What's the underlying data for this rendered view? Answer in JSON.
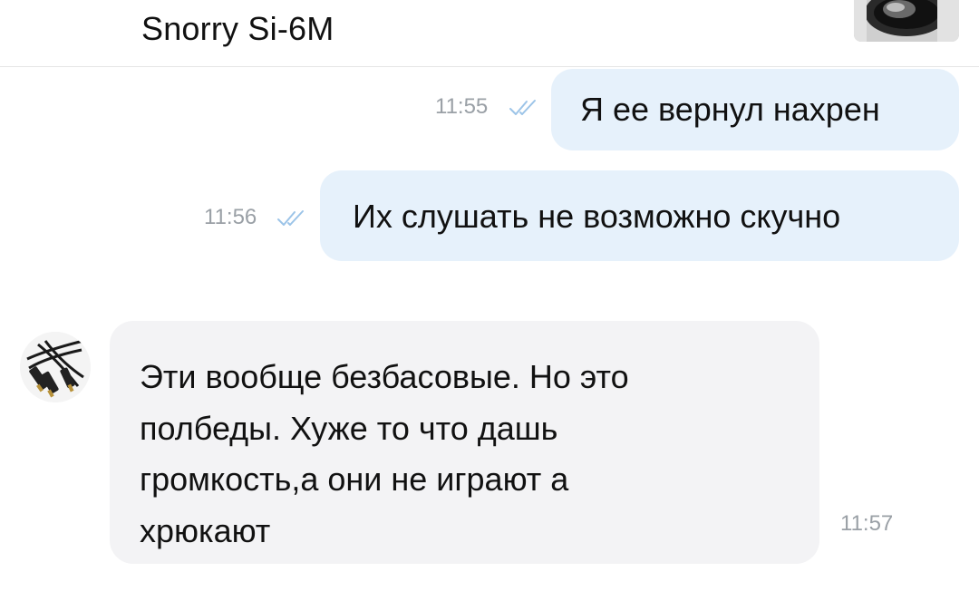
{
  "header": {
    "title": "Snorry Si-6M",
    "thumbnail_icon": "headphones-product-thumbnail"
  },
  "messages": [
    {
      "direction": "outgoing",
      "text": "Я ее вернул нахрен",
      "time": "11:55",
      "status_icon": "double-check-icon",
      "status_color": "#9cc4e8"
    },
    {
      "direction": "outgoing",
      "text": "Их слушать не возможно скучно",
      "time": "11:56",
      "status_icon": "double-check-icon",
      "status_color": "#9cc4e8"
    },
    {
      "direction": "incoming",
      "avatar_icon": "cable-avatar",
      "lines": [
        "Эти вообще безбасовые. Но это",
        "полбеды. Хуже то что дашь",
        "громкость,а они не играют а",
        "хрюкают"
      ],
      "time": "11:57"
    }
  ],
  "colors": {
    "outgoing_bubble": "#e6f1fb",
    "incoming_bubble": "#f3f3f5",
    "time_text": "#9aa0a6",
    "message_text": "#111111"
  }
}
